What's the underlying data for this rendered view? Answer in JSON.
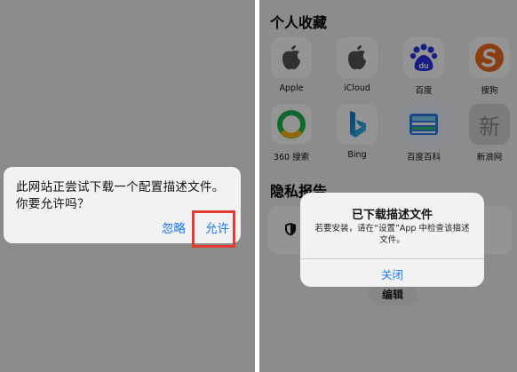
{
  "left_dialog": {
    "message": "此网站正尝试下载一个配置描述文件。你要允许吗？",
    "ignore_label": "忽略",
    "allow_label": "允许"
  },
  "right": {
    "section_favorites": "个人收藏",
    "apps": [
      {
        "label": "Apple"
      },
      {
        "label": "iCloud"
      },
      {
        "label": "百度"
      },
      {
        "label": "搜狗"
      },
      {
        "label": "360 搜索"
      },
      {
        "label": "Bing"
      },
      {
        "label": "百度百科"
      },
      {
        "label": "新浪网"
      }
    ],
    "section_privacy": "隐私报告",
    "edit_label": "编辑",
    "sina_glyph": "新",
    "baidu_glyph": "du",
    "dialog": {
      "title": "已下载描述文件",
      "message": "若要安装，请在“设置”App 中检查该描述文件。",
      "close_label": "关闭"
    }
  },
  "colors": {
    "accent": "#1677ff",
    "highlight": "#e03c31",
    "baidu": "#2932e1",
    "sogou": "#f26b21",
    "qihoo": "#1bb34c"
  }
}
